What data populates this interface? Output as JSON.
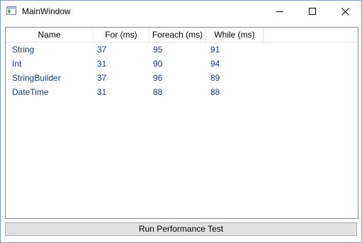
{
  "window": {
    "title": "MainWindow",
    "icon": "app-window-icon"
  },
  "grid": {
    "columns": [
      "Name",
      "For (ms)",
      "Foreach (ms)",
      "While (ms)"
    ],
    "rows": [
      [
        "String",
        "37",
        "95",
        "91"
      ],
      [
        "Int",
        "31",
        "90",
        "94"
      ],
      [
        "StringBuilder",
        "37",
        "96",
        "89"
      ],
      [
        "DateTime",
        "31",
        "88",
        "88"
      ]
    ],
    "text_color": "#1c3d79"
  },
  "actions": {
    "run_label": "Run Performance Test"
  }
}
